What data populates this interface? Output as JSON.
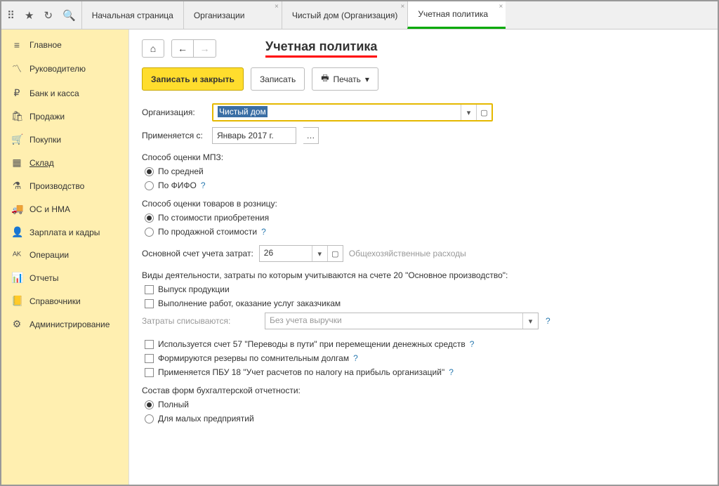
{
  "tabs": [
    "Начальная страница",
    "Организации",
    "Чистый дом (Организация)",
    "Учетная политика"
  ],
  "activeTab": 3,
  "sidebar": [
    {
      "icon": "≡",
      "label": "Главное"
    },
    {
      "icon": "〽",
      "label": "Руководителю"
    },
    {
      "icon": "₽",
      "label": "Банк и касса"
    },
    {
      "icon": "🛍",
      "label": "Продажи"
    },
    {
      "icon": "🛒",
      "label": "Покупки"
    },
    {
      "icon": "▦",
      "label": "Склад"
    },
    {
      "icon": "⚗",
      "label": "Производство"
    },
    {
      "icon": "🚚",
      "label": "ОС и НМА"
    },
    {
      "icon": "👤",
      "label": "Зарплата и кадры"
    },
    {
      "icon": "ᴬᴷ",
      "label": "Операции"
    },
    {
      "icon": "📊",
      "label": "Отчеты"
    },
    {
      "icon": "📒",
      "label": "Справочники"
    },
    {
      "icon": "⚙",
      "label": "Администрирование"
    }
  ],
  "pageTitle": "Учетная политика",
  "buttons": {
    "saveClose": "Записать и закрыть",
    "save": "Записать",
    "print": "Печать"
  },
  "labels": {
    "org": "Организация:",
    "appliesFrom": "Применяется с:",
    "mpz": "Способ оценки МПЗ:",
    "avg": "По средней",
    "fifo": "По ФИФО",
    "retail": "Способ оценки товаров в розницу:",
    "purchase": "По стоимости приобретения",
    "sale": "По продажной стоимости",
    "mainAccount": "Основной счет учета затрат:",
    "accountDesc": "Общехозяйственные расходы",
    "activities": "Виды деятельности, затраты по которым учитываются на счете 20 \"Основное производство\":",
    "production": "Выпуск продукции",
    "services": "Выполнение работ, оказание услуг заказчикам",
    "writeOff": "Затраты списываются:",
    "noRevenue": "Без учета выручки",
    "account57": "Используется счет 57 \"Переводы в пути\" при перемещении денежных средств",
    "reserves": "Формируются резервы по сомнительным долгам",
    "pbu18": "Применяется ПБУ 18 \"Учет расчетов по налогу на прибыль организаций\"",
    "reporting": "Состав форм бухгалтерской отчетности:",
    "full": "Полный",
    "small": "Для малых предприятий"
  },
  "values": {
    "org": "Чистый дом",
    "date": "Январь 2017 г.",
    "account": "26"
  }
}
